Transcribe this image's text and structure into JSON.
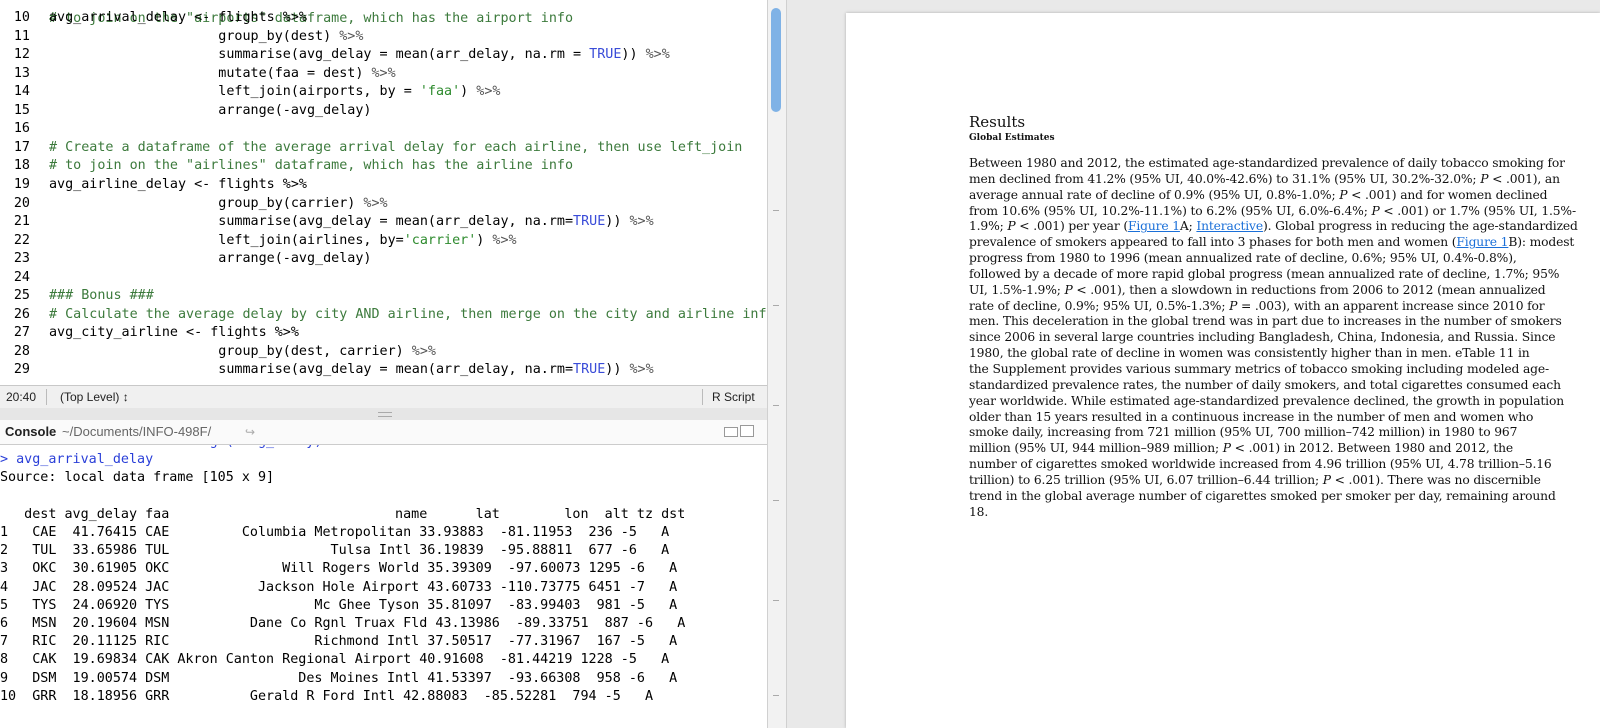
{
  "editor": {
    "lines": [
      {
        "num": "10",
        "parts": [
          {
            "t": "avg_arrival_delay <- flights %>%",
            "c": ""
          }
        ]
      },
      {
        "num": "11",
        "parts": [
          {
            "t": "                     group_by(dest) ",
            "c": ""
          },
          {
            "t": "%>%",
            "c": "op"
          }
        ]
      },
      {
        "num": "12",
        "parts": [
          {
            "t": "                     summarise(avg_delay = mean(arr_delay, na.rm = ",
            "c": ""
          },
          {
            "t": "TRUE",
            "c": "kw"
          },
          {
            "t": ")) ",
            "c": ""
          },
          {
            "t": "%>%",
            "c": "op"
          }
        ]
      },
      {
        "num": "13",
        "parts": [
          {
            "t": "                     mutate(faa = dest) ",
            "c": ""
          },
          {
            "t": "%>%",
            "c": "op"
          }
        ]
      },
      {
        "num": "14",
        "parts": [
          {
            "t": "                     left_join(airports, by = ",
            "c": ""
          },
          {
            "t": "'faa'",
            "c": "st"
          },
          {
            "t": ") ",
            "c": ""
          },
          {
            "t": "%>%",
            "c": "op"
          }
        ]
      },
      {
        "num": "15",
        "parts": [
          {
            "t": "                     arrange(-avg_delay)",
            "c": ""
          }
        ]
      },
      {
        "num": "16",
        "parts": []
      },
      {
        "num": "17",
        "parts": [
          {
            "t": "# Create a dataframe of the average arrival delay for each airline, then use left_join",
            "c": "cm"
          }
        ]
      },
      {
        "num": "18",
        "parts": [
          {
            "t": "# to join on the \"airlines\" dataframe, which has the airline info",
            "c": "cm"
          }
        ]
      },
      {
        "num": "19",
        "parts": [
          {
            "t": "avg_airline_delay <- flights %>%",
            "c": ""
          }
        ]
      },
      {
        "num": "20",
        "parts": [
          {
            "t": "                     group_by(carrier) ",
            "c": ""
          },
          {
            "t": "%>%",
            "c": "op"
          }
        ]
      },
      {
        "num": "21",
        "parts": [
          {
            "t": "                     summarise(avg_delay = mean(arr_delay, na.rm=",
            "c": ""
          },
          {
            "t": "TRUE",
            "c": "kw"
          },
          {
            "t": ")) ",
            "c": ""
          },
          {
            "t": "%>%",
            "c": "op"
          }
        ]
      },
      {
        "num": "22",
        "parts": [
          {
            "t": "                     left_join(airlines, by=",
            "c": ""
          },
          {
            "t": "'carrier'",
            "c": "st"
          },
          {
            "t": ") ",
            "c": ""
          },
          {
            "t": "%>%",
            "c": "op"
          }
        ]
      },
      {
        "num": "23",
        "parts": [
          {
            "t": "                     arrange(-avg_delay)",
            "c": ""
          }
        ]
      },
      {
        "num": "24",
        "parts": []
      },
      {
        "num": "25",
        "parts": [
          {
            "t": "### Bonus ###",
            "c": "cm"
          }
        ]
      },
      {
        "num": "26",
        "parts": [
          {
            "t": "# Calculate the average delay by city AND airline, then merge on the city and airline informa",
            "c": "cm"
          }
        ]
      },
      {
        "num": "27",
        "parts": [
          {
            "t": "avg_city_airline <- flights %>%",
            "c": ""
          }
        ]
      },
      {
        "num": "28",
        "parts": [
          {
            "t": "                     group_by(dest, carrier) ",
            "c": ""
          },
          {
            "t": "%>%",
            "c": "op"
          }
        ]
      },
      {
        "num": "29",
        "parts": [
          {
            "t": "                     summarise(avg_delay = mean(arr_delay, na.rm=",
            "c": ""
          },
          {
            "t": "TRUE",
            "c": "kw"
          },
          {
            "t": ")) ",
            "c": ""
          },
          {
            "t": "%>%",
            "c": "op"
          }
        ]
      }
    ],
    "partial_top": "# to join on the \"airports\" dataframe, which has the airport info"
  },
  "status": {
    "position": "20:40",
    "scope": "(Top Level) ↕",
    "language": "R Script"
  },
  "console": {
    "title": "Console",
    "path": "~/Documents/INFO-498F/",
    "goto_glyph": "↪",
    "lines": [
      {
        "t": "+                    arrange(-avg_delay)",
        "prompt": true
      },
      {
        "t": "> avg_arrival_delay",
        "prompt": true
      },
      {
        "t": "Source: local data frame [105 x 9]",
        "prompt": false
      },
      {
        "t": "",
        "prompt": false
      },
      {
        "t": "   dest avg_delay faa                            name      lat        lon  alt tz dst",
        "prompt": false
      },
      {
        "t": "1   CAE  41.76415 CAE         Columbia Metropolitan 33.93883  -81.11953  236 -5   A",
        "prompt": false
      },
      {
        "t": "2   TUL  33.65986 TUL                    Tulsa Intl 36.19839  -95.88811  677 -6   A",
        "prompt": false
      },
      {
        "t": "3   OKC  30.61905 OKC              Will Rogers World 35.39309  -97.60073 1295 -6   A",
        "prompt": false
      },
      {
        "t": "4   JAC  28.09524 JAC           Jackson Hole Airport 43.60733 -110.73775 6451 -7   A",
        "prompt": false
      },
      {
        "t": "5   TYS  24.06920 TYS                  Mc Ghee Tyson 35.81097  -83.99403  981 -5   A",
        "prompt": false
      },
      {
        "t": "6   MSN  20.19604 MSN          Dane Co Rgnl Truax Fld 43.13986  -89.33751  887 -6   A",
        "prompt": false
      },
      {
        "t": "7   RIC  20.11125 RIC                  Richmond Intl 37.50517  -77.31967  167 -5   A",
        "prompt": false
      },
      {
        "t": "8   CAK  19.69834 CAK Akron Canton Regional Airport 40.91608  -81.44219 1228 -5   A",
        "prompt": false
      },
      {
        "t": "9   DSM  19.00574 DSM                Des Moines Intl 41.53397  -93.66308  958 -6   A",
        "prompt": false
      },
      {
        "t": "10  GRR  18.18956 GRR          Gerald R Ford Intl 42.88083  -85.52281  794 -5   A",
        "prompt": false
      }
    ]
  },
  "document": {
    "heading": "Results",
    "subheading": "Global Estimates",
    "lines": [
      [
        {
          "t": "Between 1980 and 2012, the estimated age-standardized prevalence of daily tobacco smoking for"
        }
      ],
      [
        {
          "t": "men declined from 41.2% (95% UI, 40.0%-42.6%) to 31.1% (95% UI, 30.2%-32.0%; "
        },
        {
          "t": "P",
          "i": true
        },
        {
          "t": " < .001), an"
        }
      ],
      [
        {
          "t": "average annual rate of decline of 0.9% (95% UI, 0.8%-1.0%; "
        },
        {
          "t": "P",
          "i": true
        },
        {
          "t": " < .001) and for women declined"
        }
      ],
      [
        {
          "t": "from 10.6% (95% UI, 10.2%-11.1%) to 6.2% (95% UI, 6.0%-6.4%; "
        },
        {
          "t": "P",
          "i": true
        },
        {
          "t": " < .001) or 1.7% (95% UI, 1.5%-"
        }
      ],
      [
        {
          "t": "1.9%; "
        },
        {
          "t": "P",
          "i": true
        },
        {
          "t": " < .001) per year ("
        },
        {
          "t": "Figure 1",
          "l": true
        },
        {
          "t": "A; "
        },
        {
          "t": "Interactive",
          "l": true
        },
        {
          "t": "). Global progress in reducing the age-standardized"
        }
      ],
      [
        {
          "t": "prevalence of smokers appeared to fall into 3 phases for both men and women ("
        },
        {
          "t": "Figure 1",
          "l": true
        },
        {
          "t": "B): modest"
        }
      ],
      [
        {
          "t": "progress from 1980 to 1996 (mean annualized rate of decline, 0.6%; 95% UI, 0.4%-0.8%),"
        }
      ],
      [
        {
          "t": "followed by a decade of more rapid global progress (mean annualized rate of decline, 1.7%; 95%"
        }
      ],
      [
        {
          "t": "UI, 1.5%-1.9%; "
        },
        {
          "t": "P",
          "i": true
        },
        {
          "t": " < .001), then a slowdown in reductions from 2006 to 2012 (mean annualized"
        }
      ],
      [
        {
          "t": "rate of decline, 0.9%; 95% UI, 0.5%-1.3%; "
        },
        {
          "t": "P",
          "i": true
        },
        {
          "t": " = .003), with an apparent increase since 2010 for"
        }
      ],
      [
        {
          "t": "men. This deceleration in the global trend was in part due to increases in the number of smokers"
        }
      ],
      [
        {
          "t": "since 2006 in several large countries including Bangladesh, China, Indonesia, and Russia. Since"
        }
      ],
      [
        {
          "t": "1980, the global rate of decline in women was consistently higher than in men. eTable 11 in"
        }
      ],
      [
        {
          "t": "the Supplement provides various summary metrics of tobacco smoking including modeled age-"
        }
      ],
      [
        {
          "t": "standardized prevalence rates, the number of daily smokers, and total cigarettes consumed each"
        }
      ],
      [
        {
          "t": "year worldwide. While estimated age-standardized prevalence declined, the growth in population"
        }
      ],
      [
        {
          "t": "older than 15 years resulted in a continuous increase in the number of men and women who"
        }
      ],
      [
        {
          "t": "smoke daily, increasing from 721 million (95% UI, 700 million–742 million) in 1980 to 967"
        }
      ],
      [
        {
          "t": "million (95% UI, 944 million–989 million; "
        },
        {
          "t": "P",
          "i": true
        },
        {
          "t": " < .001) in 2012. Between 1980 and 2012, the"
        }
      ],
      [
        {
          "t": "number of cigarettes smoked worldwide increased from 4.96 trillion (95% UI, 4.78 trillion–5.16"
        }
      ],
      [
        {
          "t": "trillion) to 6.25 trillion (95% UI, 6.07 trillion–6.44 trillion; "
        },
        {
          "t": "P",
          "i": true
        },
        {
          "t": " < .001). There was no discernible"
        }
      ],
      [
        {
          "t": "trend in the global average number of cigarettes smoked per smoker per day, remaining around"
        }
      ],
      [
        {
          "t": "18."
        }
      ]
    ]
  },
  "colors": {
    "comment": "#3c7a3c",
    "keyword": "#3a4cd8",
    "string": "#2e8b2e",
    "prompt": "#2a3fd8",
    "link": "#1a6fd8",
    "scroll_thumb": "#7fb2e6"
  }
}
